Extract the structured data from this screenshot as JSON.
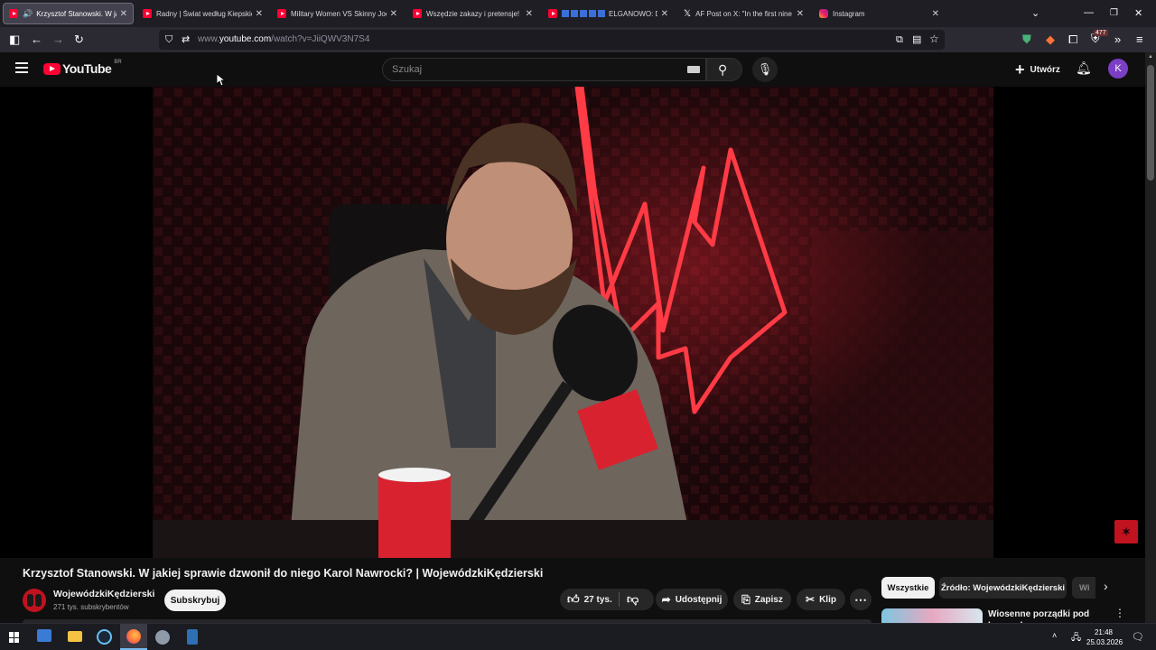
{
  "tabs": [
    {
      "title": "Krzysztof Stanowski. W jaki",
      "favicon": "youtube-icon",
      "active": true
    },
    {
      "title": "Radny | Świat według Kiepskich",
      "favicon": "youtube-icon",
      "active": false
    },
    {
      "title": "Military Women VS Skinny Joes",
      "favicon": "youtube-icon",
      "active": false
    },
    {
      "title": "Wszędzie zakazy i pretensje! Lu",
      "favicon": "youtube-icon",
      "active": false
    },
    {
      "title": "ELGANOWO: D",
      "favicon": "youtube-icon",
      "active": false
    },
    {
      "title": "AF Post on X: \"In the first nine n",
      "favicon": "x-icon",
      "active": false
    },
    {
      "title": "Instagram",
      "favicon": "instagram-icon",
      "active": false
    }
  ],
  "browser": {
    "url_prefix": "www.",
    "url_domain": "youtube.com",
    "url_path": "/watch?v=JiiQWV3N7S4",
    "extension_badge": "477"
  },
  "youtube": {
    "logo_text": "YouTube",
    "country_code": "BR",
    "search_placeholder": "Szukaj",
    "create_label": "Utwórz",
    "avatar_letter": "K"
  },
  "video": {
    "title": "Krzysztof Stanowski. W jakiej sprawie dzwonił do niego Karol Nawrocki? | WojewódzkiKędzierski",
    "channel_name": "WojewódzkiKędzierski",
    "subscribers": "271 tys. subskrybentów",
    "subscribe_label": "Subskrybuj",
    "likes": "27 tys.",
    "share_label": "Udostępnij",
    "save_label": "Zapisz",
    "clip_label": "Klip"
  },
  "chips": [
    {
      "label": "Wszystkie",
      "selected": true
    },
    {
      "label": "Źródło: WojewódzkiKędzierski",
      "selected": false
    },
    {
      "label": "Wi",
      "selected": false
    }
  ],
  "recommendation": {
    "title": "Wiosenne porządki pod komendą"
  },
  "taskbar": {
    "time": "21:48",
    "date": "25.03.2026"
  },
  "colors": {
    "yt_red": "#ff0033",
    "neon": "#ff3b45",
    "avatar": "#7b3fc4"
  }
}
